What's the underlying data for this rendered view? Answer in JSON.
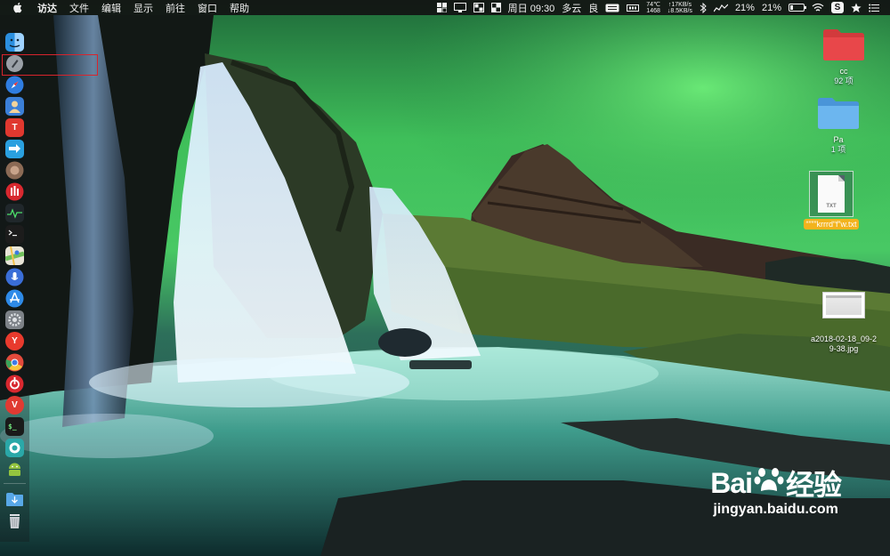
{
  "menubar": {
    "app_name": "访达",
    "menus": [
      "文件",
      "编辑",
      "显示",
      "前往",
      "窗口",
      "帮助"
    ],
    "status": {
      "datetime": "周日 09:30",
      "weather": "多云",
      "air_quality": "良",
      "temperature": "74℃",
      "rpm": "1468",
      "upload_speed": "↑17KB/s",
      "download_speed": "↓8.5KB/s",
      "cpu_percent": "21%",
      "battery_percent": "21%",
      "battery_level": 0.21,
      "s_badge": "S"
    }
  },
  "dock": {
    "icons": [
      {
        "name": "finder-icon",
        "color": "#2b8fe0"
      },
      {
        "name": "launchpad-icon",
        "color": "#8a8f99"
      },
      {
        "name": "safari-icon",
        "color": "#2f7de1"
      },
      {
        "name": "contacts-icon",
        "color": "#3b7fd8"
      },
      {
        "name": "app-t-icon",
        "color": "#e0382f",
        "glyph": "T"
      },
      {
        "name": "migration-icon",
        "color": "#2aa0e0"
      },
      {
        "name": "gyro-icon",
        "color": "#8b6a55"
      },
      {
        "name": "netease-music-icon",
        "color": "#d8282f"
      },
      {
        "name": "activity-monitor-icon",
        "color": "#20272b"
      },
      {
        "name": "terminal-icon",
        "color": "#1c1c1c"
      },
      {
        "name": "maps-icon",
        "color": "#6fbf5b"
      },
      {
        "name": "siri-icon",
        "color": "#3a6ed8"
      },
      {
        "name": "app-store-icon",
        "color": "#2e8ae8"
      },
      {
        "name": "system-preferences-icon",
        "color": "#7d8288"
      },
      {
        "name": "yandex-icon",
        "color": "#e83a2d",
        "glyph": "Y"
      },
      {
        "name": "chrome-icon",
        "color": "#e34a3c"
      },
      {
        "name": "netease-cloud-icon",
        "color": "#d8282f"
      },
      {
        "name": "vivaldi-icon",
        "color": "#e03a32",
        "glyph": "V"
      },
      {
        "name": "shell-icon",
        "color": "#1a1a1a"
      },
      {
        "name": "teal-app-icon",
        "color": "#2aa8a8"
      },
      {
        "name": "android-icon",
        "color": "#93c43f"
      },
      {
        "name": "downloads-folder-icon",
        "color": "#58a8e8"
      },
      {
        "name": "trash-icon",
        "color": "#c8cdd2"
      }
    ]
  },
  "desktop": {
    "folder_cc": {
      "name": "cc",
      "count": "92 项",
      "color": "#e8474a"
    },
    "folder_pa": {
      "name": "Pa",
      "count": "1 项",
      "color": "#5aaae8"
    },
    "txt_file": {
      "name": "“”””krrrd“f”w.txt",
      "ext": "TXT",
      "label_color": "#f3b31d"
    },
    "image_file": {
      "name_line1": "a2018-02-18_09-2",
      "name_line2": "9-38.jpg"
    }
  },
  "watermark": {
    "brand": "Bai",
    "brand_suffix": "经验",
    "url": "jingyan.baidu.com"
  }
}
